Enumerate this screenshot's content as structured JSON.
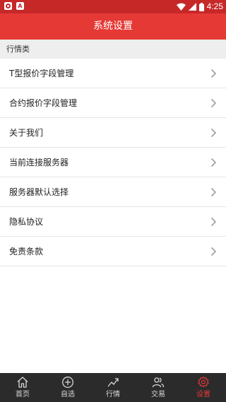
{
  "status_bar": {
    "time": "4:25",
    "notification_badge": "A"
  },
  "header": {
    "title": "系统设置"
  },
  "section": {
    "label": "行情类"
  },
  "settings": {
    "items": [
      {
        "label": "T型报价字段管理"
      },
      {
        "label": "合约报价字段管理"
      },
      {
        "label": "关于我们"
      },
      {
        "label": "当前连接服务器"
      },
      {
        "label": "服务器默认选择"
      },
      {
        "label": "隐私协议"
      },
      {
        "label": "免责条款"
      }
    ]
  },
  "bottom_nav": {
    "items": [
      {
        "label": "首页",
        "icon": "home-icon",
        "active": false
      },
      {
        "label": "自选",
        "icon": "plus-circle-icon",
        "active": false
      },
      {
        "label": "行情",
        "icon": "trend-icon",
        "active": false
      },
      {
        "label": "交易",
        "icon": "users-icon",
        "active": false
      },
      {
        "label": "设置",
        "icon": "gear-icon",
        "active": true
      }
    ]
  },
  "colors": {
    "status_bar": "#c62828",
    "header": "#e53935",
    "active_tab": "#e53935",
    "nav_background": "#2b2b2b"
  }
}
